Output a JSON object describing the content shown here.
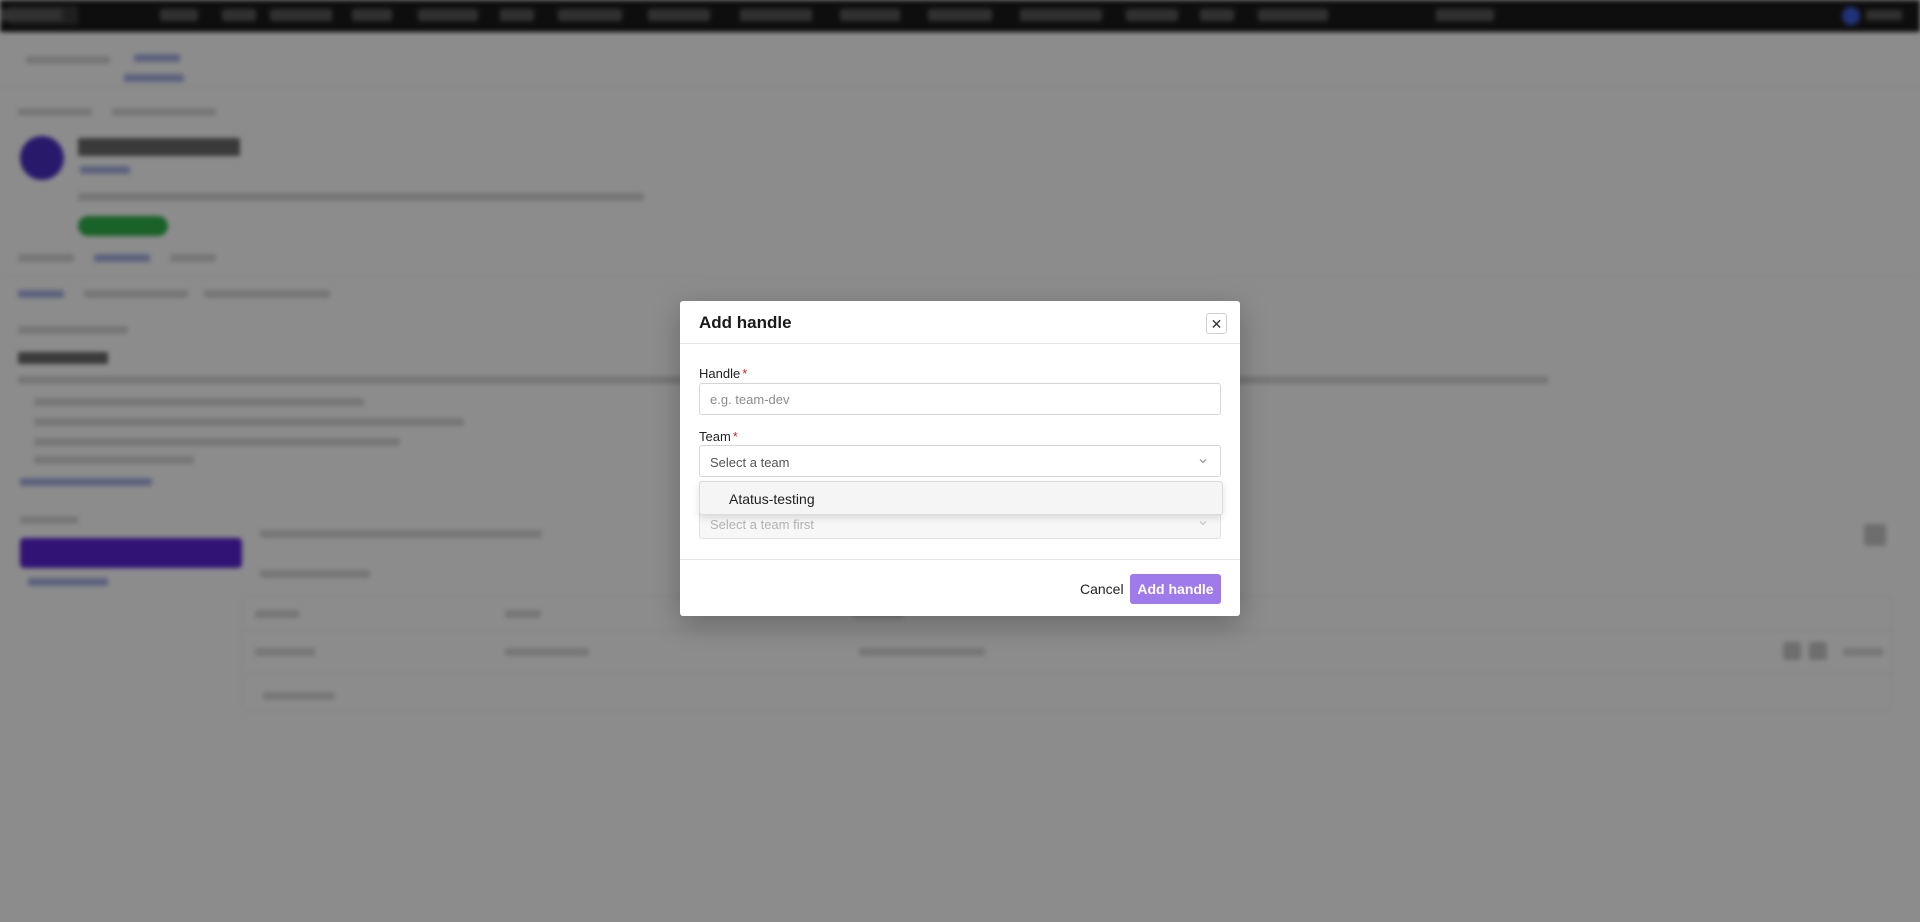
{
  "modal": {
    "title": "Add handle",
    "close_symbol": "✕",
    "handle": {
      "label": "Handle",
      "required_mark": "*",
      "placeholder": "e.g. team-dev",
      "value": ""
    },
    "team": {
      "label": "Team",
      "required_mark": "*",
      "placeholder": "Select a team",
      "dropdown_options": [
        "Atatus-testing"
      ]
    },
    "third_field": {
      "placeholder": "Select a team first"
    },
    "footer": {
      "cancel_label": "Cancel",
      "submit_label": "Add handle"
    }
  },
  "icons": {
    "close": "close-icon",
    "chevron": "chevron-down-icon"
  },
  "colors": {
    "primary_button": "#9f7aea",
    "required_mark": "#d32020",
    "overlay": "rgba(0,0,0,0.45)"
  }
}
